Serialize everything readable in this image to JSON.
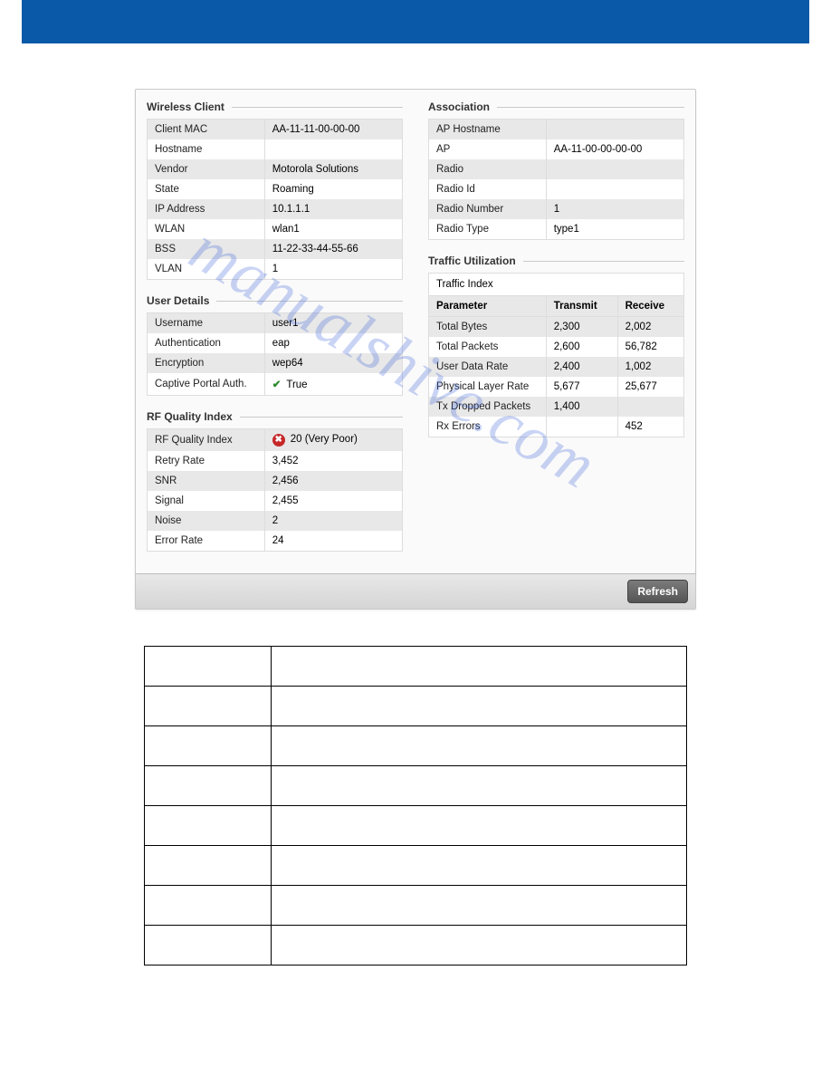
{
  "watermark": "manualshive.com",
  "sections": {
    "wireless_client": {
      "title": "Wireless Client",
      "rows": [
        {
          "label": "Client MAC",
          "value": "AA-11-11-00-00-00"
        },
        {
          "label": "Hostname",
          "value": ""
        },
        {
          "label": "Vendor",
          "value": "Motorola Solutions"
        },
        {
          "label": "State",
          "value": "Roaming"
        },
        {
          "label": "IP Address",
          "value": "10.1.1.1"
        },
        {
          "label": "WLAN",
          "value": " wlan1"
        },
        {
          "label": "BSS",
          "value": "11-22-33-44-55-66"
        },
        {
          "label": "VLAN",
          "value": " 1"
        }
      ]
    },
    "user_details": {
      "title": "User Details",
      "rows": [
        {
          "label": "Username",
          "value": "user1"
        },
        {
          "label": "Authentication",
          "value": "eap"
        },
        {
          "label": "Encryption",
          "value": "wep64"
        },
        {
          "label": "Captive Portal Auth.",
          "value": "True",
          "icon": "check"
        }
      ]
    },
    "rf_quality": {
      "title": "RF Quality Index",
      "rows": [
        {
          "label": "RF Quality Index",
          "value": "20 (Very Poor)",
          "icon": "bad"
        },
        {
          "label": "Retry Rate",
          "value": "3,452"
        },
        {
          "label": "SNR",
          "value": "2,456"
        },
        {
          "label": "Signal",
          "value": "2,455"
        },
        {
          "label": "Noise",
          "value": "2"
        },
        {
          "label": "Error Rate",
          "value": "24"
        }
      ]
    },
    "association": {
      "title": "Association",
      "rows": [
        {
          "label": "AP Hostname",
          "value": ""
        },
        {
          "label": "AP",
          "value": "AA-11-00-00-00-00"
        },
        {
          "label": "Radio",
          "value": ""
        },
        {
          "label": "Radio Id",
          "value": ""
        },
        {
          "label": "Radio Number",
          "value": "1"
        },
        {
          "label": "Radio Type",
          "value": "type1"
        }
      ]
    },
    "traffic": {
      "title": "Traffic Utilization",
      "index_label": "Traffic Index",
      "headers": {
        "param": "Parameter",
        "tx": "Transmit",
        "rx": "Receive"
      },
      "rows": [
        {
          "param": "Total Bytes",
          "tx": "2,300",
          "rx": "2,002"
        },
        {
          "param": "Total Packets",
          "tx": "2,600",
          "rx": "56,782"
        },
        {
          "param": "User Data Rate",
          "tx": "2,400",
          "rx": "1,002"
        },
        {
          "param": "Physical Layer Rate",
          "tx": "5,677",
          "rx": "25,677"
        },
        {
          "param": "Tx Dropped Packets",
          "tx": "1,400",
          "rx": ""
        },
        {
          "param": "Rx Errors",
          "tx": "",
          "rx": "452"
        }
      ]
    }
  },
  "buttons": {
    "refresh": "Refresh"
  },
  "def_rows": 8
}
